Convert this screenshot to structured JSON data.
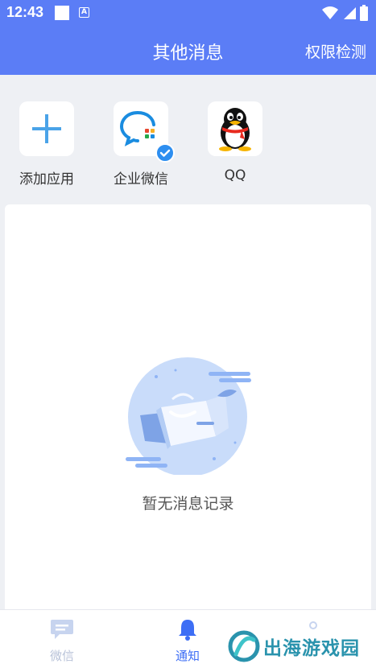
{
  "status_bar": {
    "time": "12:43",
    "notification_icons": [
      "square-icon",
      "a-icon"
    ],
    "system_icons": [
      "wifi-icon",
      "signal-icon",
      "battery-icon"
    ]
  },
  "header": {
    "title": "其他消息",
    "action": "权限检测",
    "background": "#5b7df6"
  },
  "apps": [
    {
      "label": "添加应用",
      "icon": "plus-icon"
    },
    {
      "label": "企业微信",
      "icon": "wecom-icon",
      "checked": true
    },
    {
      "label": "QQ",
      "icon": "qq-penguin-icon"
    }
  ],
  "empty_state": {
    "text": "暂无消息记录",
    "illustration": "empty-box-icon"
  },
  "tabs": [
    {
      "label": "微信",
      "icon": "chat-icon",
      "active": false
    },
    {
      "label": "通知",
      "icon": "bell-icon",
      "active": true
    },
    {
      "label": "",
      "icon": "profile-icon",
      "active": false
    }
  ],
  "watermark": {
    "text": "出海游戏园"
  }
}
